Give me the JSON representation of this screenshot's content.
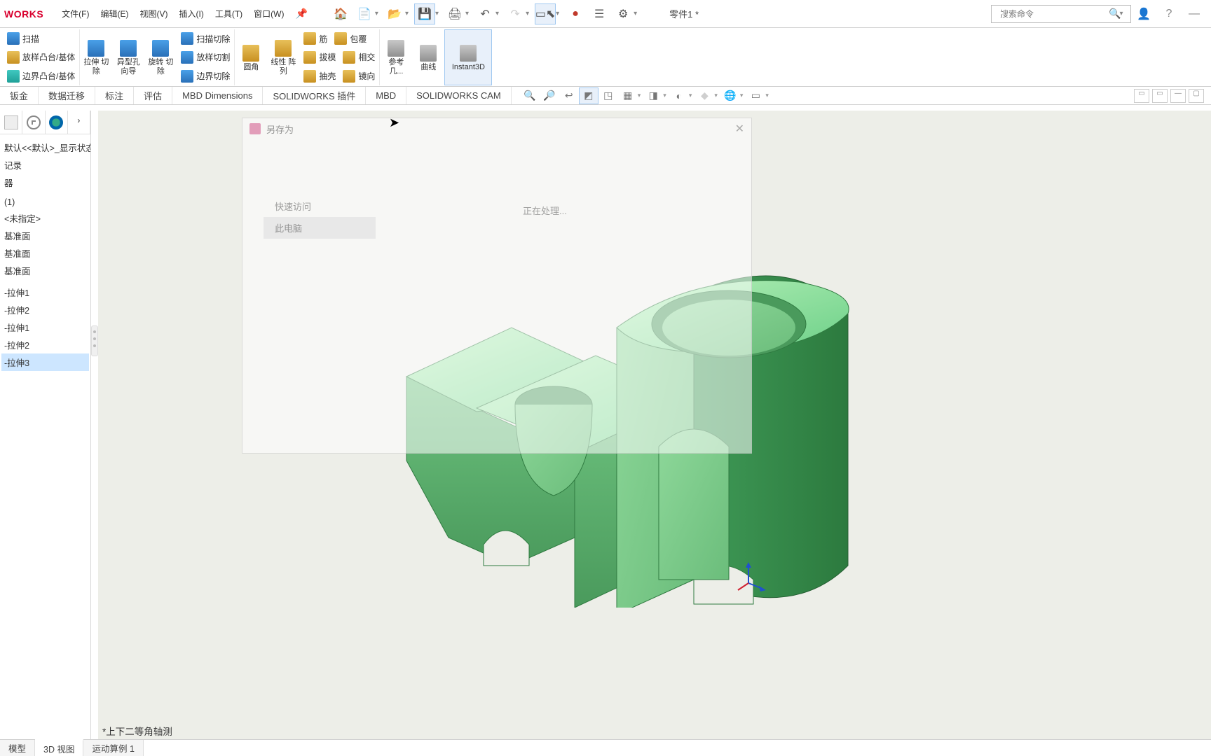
{
  "app": {
    "logo_text": "WORKS"
  },
  "menubar": {
    "items": [
      "文件(F)",
      "编辑(E)",
      "视图(V)",
      "插入(I)",
      "工具(T)",
      "窗口(W)"
    ],
    "doc_name": "零件1 *",
    "search_placeholder": "搜索命令"
  },
  "ribbon": {
    "group_sweep": {
      "scan": "扫描",
      "loft": "放样凸台/基体",
      "boundary": "边界凸台/基体"
    },
    "big": {
      "extrude_cut": "拉伸\n切除",
      "hole_wizard": "异型孔\n向导",
      "revolve_cut": "旋转\n切除"
    },
    "group_cut": {
      "sweep_cut": "扫描切除",
      "loft_cut": "放样切割",
      "boundary_cut": "边界切除"
    },
    "big2": {
      "fillet": "圆角",
      "pattern": "线性\n阵列"
    },
    "group_mid": {
      "rib": "筋",
      "draft": "拔模",
      "shell": "抽壳",
      "wrap": "包覆",
      "intersect": "相交",
      "mirror": "镜向"
    },
    "big3": {
      "refgeo": "参考\n几...",
      "curve": "曲线",
      "instant3d": "Instant3D"
    }
  },
  "tabs": [
    "钣金",
    "数据迁移",
    "标注",
    "评估",
    "MBD Dimensions",
    "SOLIDWORKS 插件",
    "MBD",
    "SOLIDWORKS CAM"
  ],
  "tree": {
    "items": [
      "默认<<默认>_显示状态",
      "记录",
      "器",
      "",
      "(1)",
      "<未指定>",
      "基准面",
      "基准面",
      "基准面",
      "",
      "-拉伸1",
      "-拉伸2",
      "-拉伸1",
      "-拉伸2",
      "-拉伸3"
    ],
    "selected_index": 14
  },
  "dialog": {
    "title": "另存为",
    "nav_quick": "快速访问",
    "nav_thispc": "此电脑",
    "status": "正在处理..."
  },
  "viewname": "*上下二等角轴测",
  "bottom_tabs": [
    "模型",
    "3D 视图",
    "运动算例 1"
  ]
}
